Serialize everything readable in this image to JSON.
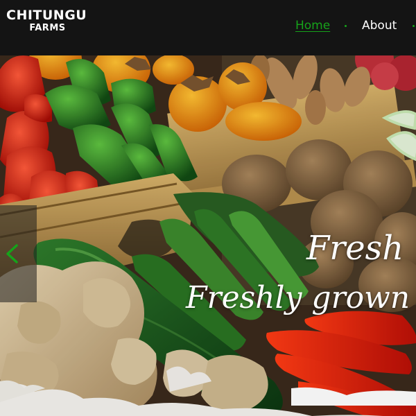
{
  "brand": {
    "name": "CHITUNGU",
    "subname": "FARMS"
  },
  "nav": {
    "items": [
      {
        "label": "Home",
        "active": true
      },
      {
        "label": "About",
        "active": false
      }
    ]
  },
  "hero": {
    "title": "Fresh",
    "subtitle": "Freshly grown"
  },
  "colors": {
    "accent": "#16a31a",
    "navbar_bg": "#141414",
    "text": "#ffffff"
  }
}
